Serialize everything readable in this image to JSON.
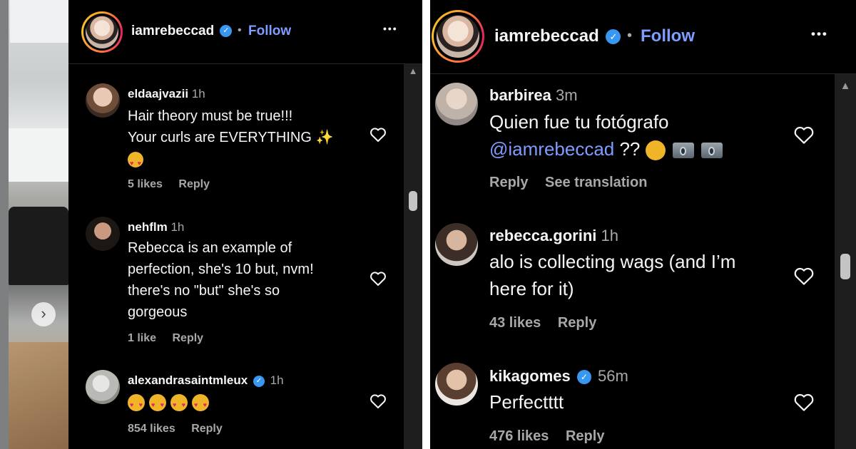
{
  "left": {
    "header": {
      "username": "iamrebeccad",
      "separator": "•",
      "follow_label": "Follow",
      "more_label": "•••"
    },
    "comments": [
      {
        "user": "eldaajvazii",
        "time": "1h",
        "text_lines": [
          "Hair theory must be true!!!",
          "Your curls are EVERYTHING"
        ],
        "likes": "5 likes",
        "reply": "Reply"
      },
      {
        "user": "nehflm",
        "time": "1h",
        "text_lines": [
          "Rebecca is an example of",
          "perfection, she's 10 but, nvm!",
          "there's no \"but\" she's so",
          "gorgeous"
        ],
        "likes": "1 like",
        "reply": "Reply"
      },
      {
        "user": "alexandrasaintmleux",
        "time": "1h",
        "verified": true,
        "likes": "854 likes",
        "reply": "Reply"
      }
    ],
    "photo_nav_icon": "chevron-right-icon"
  },
  "right": {
    "header": {
      "username": "iamrebeccad",
      "separator": "•",
      "follow_label": "Follow",
      "more_label": "•••"
    },
    "comments": [
      {
        "user": "barbirea",
        "time": "3m",
        "text_line1": "Quien fue tu fotógrafo",
        "mention": "@iamrebeccad",
        "after_mention": " ?? ",
        "reply": "Reply",
        "see_translation": "See translation"
      },
      {
        "user": "rebecca.gorini",
        "time": "1h",
        "text_lines": [
          "alo is collecting wags (and I’m",
          "here for it)"
        ],
        "likes": "43 likes",
        "reply": "Reply"
      },
      {
        "user": "kikagomes",
        "time": "56m",
        "verified": true,
        "text": "Perfectttt",
        "likes": "476 likes",
        "reply": "Reply"
      }
    ]
  },
  "icons": [
    "verified-badge-icon",
    "heart-icon",
    "more-options-icon",
    "sparkles-icon",
    "heart-eyes-emoji",
    "grimace-emoji",
    "camera-emoji",
    "scroll-up-arrow-icon"
  ],
  "colors": {
    "background": "#000000",
    "follow": "#7f9cff",
    "mention": "#7f9cff",
    "verified": "#3897f0",
    "secondary_text": "#a8a8a8"
  }
}
